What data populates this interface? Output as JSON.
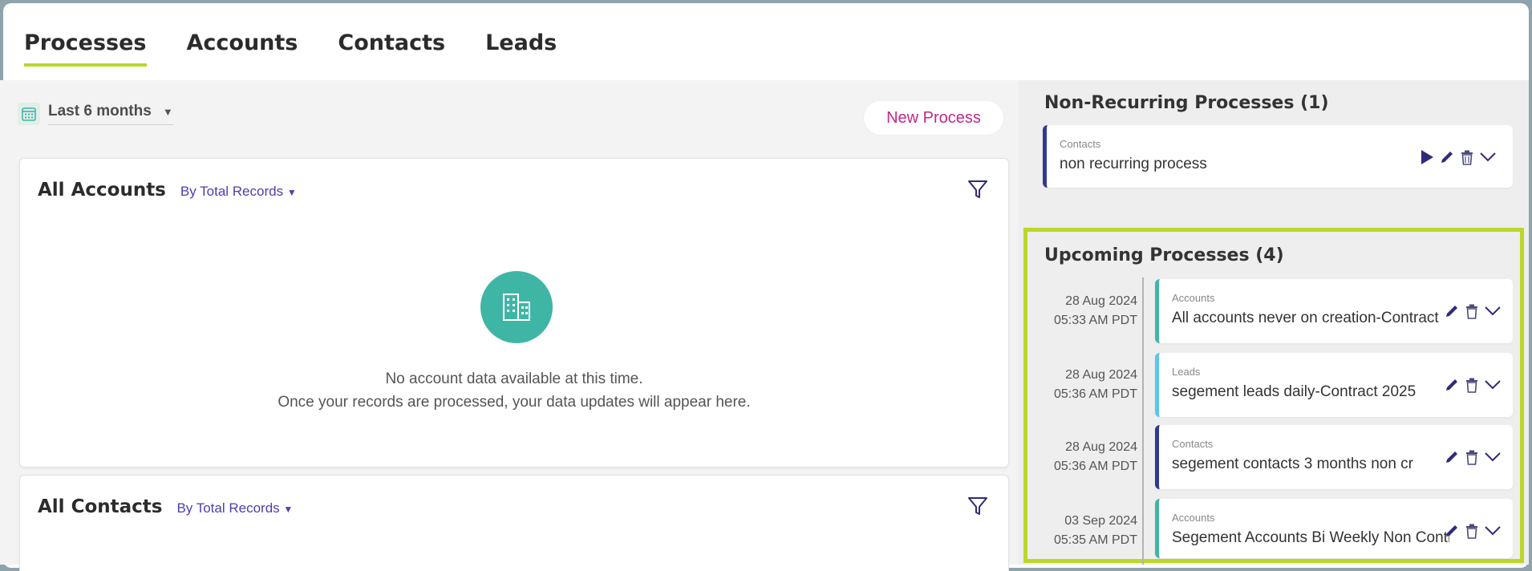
{
  "tabs": [
    {
      "label": "Processes",
      "active": true
    },
    {
      "label": "Accounts",
      "active": false
    },
    {
      "label": "Contacts",
      "active": false
    },
    {
      "label": "Leads",
      "active": false
    }
  ],
  "date_range": {
    "label": "Last 6 months",
    "icon": "calendar-icon"
  },
  "new_process_label": "New Process",
  "accounts_card": {
    "title": "All Accounts",
    "sort_label": "By Total Records",
    "icon": "buildings-icon",
    "empty_line1": "No account data available at this time.",
    "empty_line2": "Once your records are processed, your data updates will appear here."
  },
  "contacts_card": {
    "title": "All Contacts",
    "sort_label": "By Total Records"
  },
  "non_recurring": {
    "title": "Non-Recurring Processes (1)",
    "items": [
      {
        "category": "Contacts",
        "name": "non recurring process",
        "accent": "#2f3a8f"
      }
    ]
  },
  "upcoming": {
    "title": "Upcoming Processes (4)",
    "items": [
      {
        "date": "28 Aug 2024",
        "time": "05:33 AM PDT",
        "category": "Accounts",
        "name": "All accounts never on creation-Contract",
        "accent": "#3fb6a5"
      },
      {
        "date": "28 Aug 2024",
        "time": "05:36 AM PDT",
        "category": "Leads",
        "name": "segement leads daily-Contract 2025",
        "accent": "#5bc6e8"
      },
      {
        "date": "28 Aug 2024",
        "time": "05:36 AM PDT",
        "category": "Contacts",
        "name": "segement contacts 3 months non cr",
        "accent": "#2f3a8f"
      },
      {
        "date": "03 Sep 2024",
        "time": "05:35 AM PDT",
        "category": "Accounts",
        "name": "Segement Accounts Bi Weekly Non Contract",
        "accent": "#3fb6a5"
      }
    ]
  },
  "colors": {
    "highlight": "#bdd62b",
    "brand_magenta": "#c2288b",
    "link": "#4b3fb0",
    "icon_navy": "#2f2b7a"
  }
}
